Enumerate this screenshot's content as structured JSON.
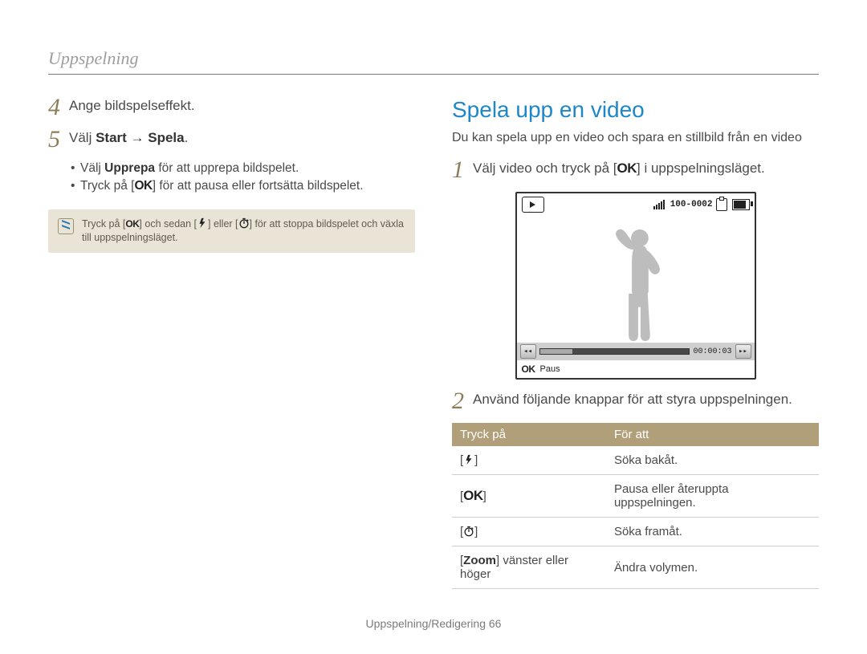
{
  "header": "Uppspelning",
  "left": {
    "step4_num": "4",
    "step4_text": "Ange bildspelseffekt.",
    "step5_num": "5",
    "step5_pre": "Välj ",
    "step5_bold": "Start → Spela",
    "step5_post": ".",
    "bullet1_pre": "Välj ",
    "bullet1_bold": "Upprepa",
    "bullet1_post": " för att upprepa bildspelet.",
    "bullet2_pre": "Tryck på [",
    "bullet2_post": "] för att pausa eller fortsätta bildspelet.",
    "note_a": "Tryck på [",
    "note_b": "] och sedan [",
    "note_c": "] eller [",
    "note_d": "] för att stoppa bildspelet och växla till uppspelningsläget."
  },
  "right": {
    "heading": "Spela upp en video",
    "intro": "Du kan spela upp en video och spara en stillbild från en video",
    "step1_num": "1",
    "step1_pre": "Välj video och tryck på [",
    "step1_post": "] i uppspelningsläget.",
    "step2_num": "2",
    "step2_text": "Använd följande knappar för att styra uppspelningen.",
    "screen": {
      "counter": "100-0002",
      "time": "00:00:03",
      "foot": "Paus"
    },
    "table": {
      "h1": "Tryck på",
      "h2": "För att",
      "r1v": "Söka bakåt.",
      "r2v": "Pausa eller återuppta uppspelningen.",
      "r3v": "Söka framåt.",
      "r4k_a": "[",
      "r4k_b": "Zoom",
      "r4k_c": "] vänster eller höger",
      "r4v": "Ändra volymen."
    }
  },
  "ok_label": "OK",
  "footer_a": "Uppspelning/Redigering ",
  "footer_b": "66"
}
